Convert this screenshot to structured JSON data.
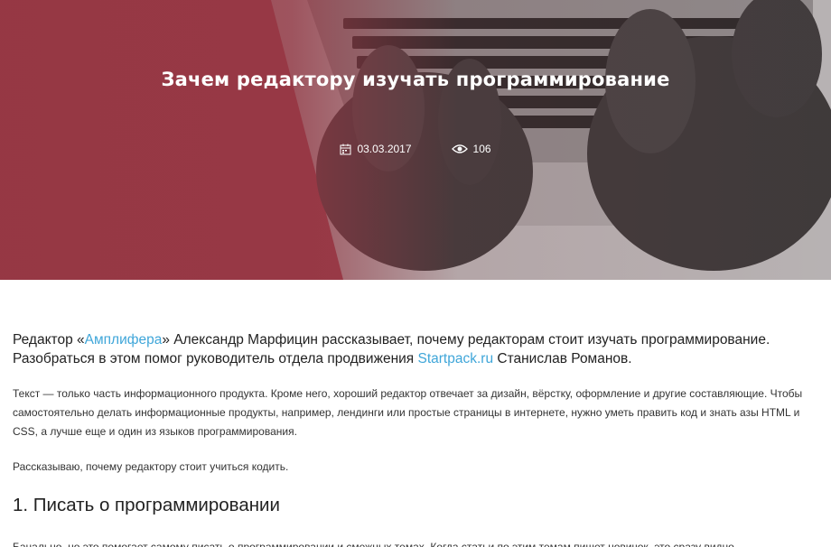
{
  "hero": {
    "title": "Зачем редактору изучать программирование",
    "date": "03.03.2017",
    "views": "106",
    "calendar_icon": "calendar-icon",
    "eye_icon": "eye-icon",
    "overlay_color": "#9a3c48"
  },
  "article": {
    "lead_prefix": "Редактор «",
    "lead_link1": "Амплифера",
    "lead_mid": "» Александр Марфицин рассказывает, почему редакторам стоит изучать программирование. Разобраться в этом помог руководитель отдела продвижения ",
    "lead_link2": "Startpack.ru",
    "lead_suffix": " Станислав Романов.",
    "paragraph1": "Текст — только часть информационного продукта. Кроме него, хороший редактор отвечает за дизайн, вёрстку, оформление и другие составляющие. Чтобы самостоятельно делать информационные продукты, например, лендинги или простые страницы в интернете, нужно уметь править код и знать азы HTML и CSS, а лучше еще и один из языков программирования.",
    "paragraph2": "Рассказываю, почему редактору стоит учиться кодить.",
    "heading1": "1. Писать о программировании",
    "paragraph3": "Банально, но это помогает самому писать о программировании и смежных темах. Когда статьи по этим темам пишет новичок, это сразу видно —",
    "link_color": "#3fa6d9"
  }
}
